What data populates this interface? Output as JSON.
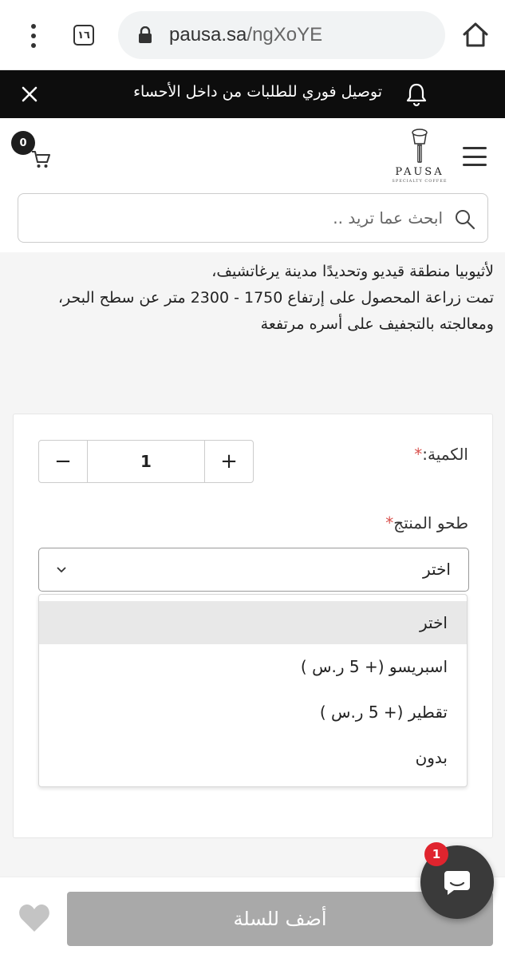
{
  "browser": {
    "tab_count": "١٦",
    "url_domain": "pausa.sa",
    "url_path": "/ngXoYE"
  },
  "announcement": {
    "text": "توصيل فوري للطلبات من داخل الأحساء"
  },
  "header": {
    "logo_word": "PAUSA",
    "logo_sub": "SPECIALTY COFFEE",
    "cart_count": "0"
  },
  "search": {
    "placeholder": "ابحث عما تريد .."
  },
  "description": {
    "lines": [
      "لأثيوبيا منطقة قيديو وتحديدًا مدينة يرغاتشيف،",
      "تمت زراعة المحصول على إرتفاع 1750 - 2300 متر عن سطح البحر،",
      "ومعالجته بالتجفيف على أسره مرتفعة"
    ]
  },
  "form": {
    "quantity_label": "الكمية:",
    "required_mark": "*",
    "quantity_value": "1",
    "minus": "−",
    "plus": "+",
    "grind_label": "طحو المنتج",
    "select_value": "اختر",
    "options": [
      "اختر",
      "اسبريسو (+ 5 ر.س )",
      "تقطير (+ 5 ر.س )",
      "بدون"
    ]
  },
  "footer": {
    "add_to_cart": "أضف للسلة"
  },
  "chat": {
    "badge": "1"
  },
  "colors": {
    "announcement_bg": "#0d0d0d",
    "button_disabled": "#a9a9a9",
    "required": "#d9534f",
    "chat_badge": "#e0242e",
    "chat_fab": "#3a3a3a"
  }
}
